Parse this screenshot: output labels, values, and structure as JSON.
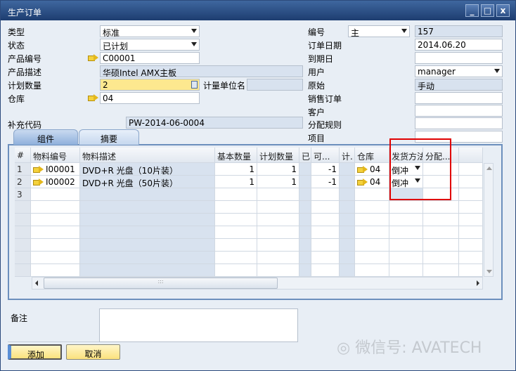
{
  "window": {
    "title": "生产订单",
    "min": "_",
    "max": "□",
    "close": "x"
  },
  "left": {
    "type": {
      "label": "类型",
      "value": "标准"
    },
    "status": {
      "label": "状态",
      "value": "已计划"
    },
    "product_no": {
      "label": "产品编号",
      "value": "C00001"
    },
    "product_desc": {
      "label": "产品描述",
      "value": "华硕Intel AMX主板"
    },
    "plan_qty": {
      "label": "计划数量",
      "value": "2"
    },
    "uom": {
      "label": "计量单位名",
      "value": ""
    },
    "warehouse": {
      "label": "仓库",
      "value": "04"
    },
    "supp_code": {
      "label": "补充代码",
      "value": "PW-2014-06-0004"
    }
  },
  "right": {
    "number": {
      "label": "编号",
      "series": "主",
      "value": "157"
    },
    "order_date": {
      "label": "订单日期",
      "value": "2014.06.20"
    },
    "due_date": {
      "label": "到期日",
      "value": ""
    },
    "user": {
      "label": "用户",
      "value": "manager"
    },
    "origin": {
      "label": "原始",
      "value": "手动"
    },
    "sales_order": {
      "label": "销售订单",
      "value": ""
    },
    "customer": {
      "label": "客户",
      "value": ""
    },
    "dist_rule": {
      "label": "分配规则",
      "value": ""
    },
    "project": {
      "label": "项目",
      "value": ""
    }
  },
  "tabs": [
    "组件",
    "摘要"
  ],
  "grid": {
    "columns": [
      "#",
      "物料编号",
      "物料描述",
      "基本数量",
      "计划数量",
      "已",
      "可...",
      "计.",
      "仓库",
      "发货方法",
      "分配..."
    ],
    "rows": [
      [
        "1",
        "I00001",
        "DVD+R 光盘（10片装）",
        "1",
        "1",
        "",
        "-1",
        "",
        "04",
        "倒冲",
        ""
      ],
      [
        "2",
        "I00002",
        "DVD+R 光盘（50片装）",
        "1",
        "1",
        "",
        "-1",
        "",
        "04",
        "倒冲",
        ""
      ],
      [
        "3",
        "",
        "",
        "",
        "",
        "",
        "",
        "",
        "",
        "",
        ""
      ]
    ]
  },
  "remarks": {
    "label": "备注",
    "value": ""
  },
  "buttons": {
    "add": "添加",
    "cancel": "取消"
  },
  "watermark": "微信号: AVATECH"
}
